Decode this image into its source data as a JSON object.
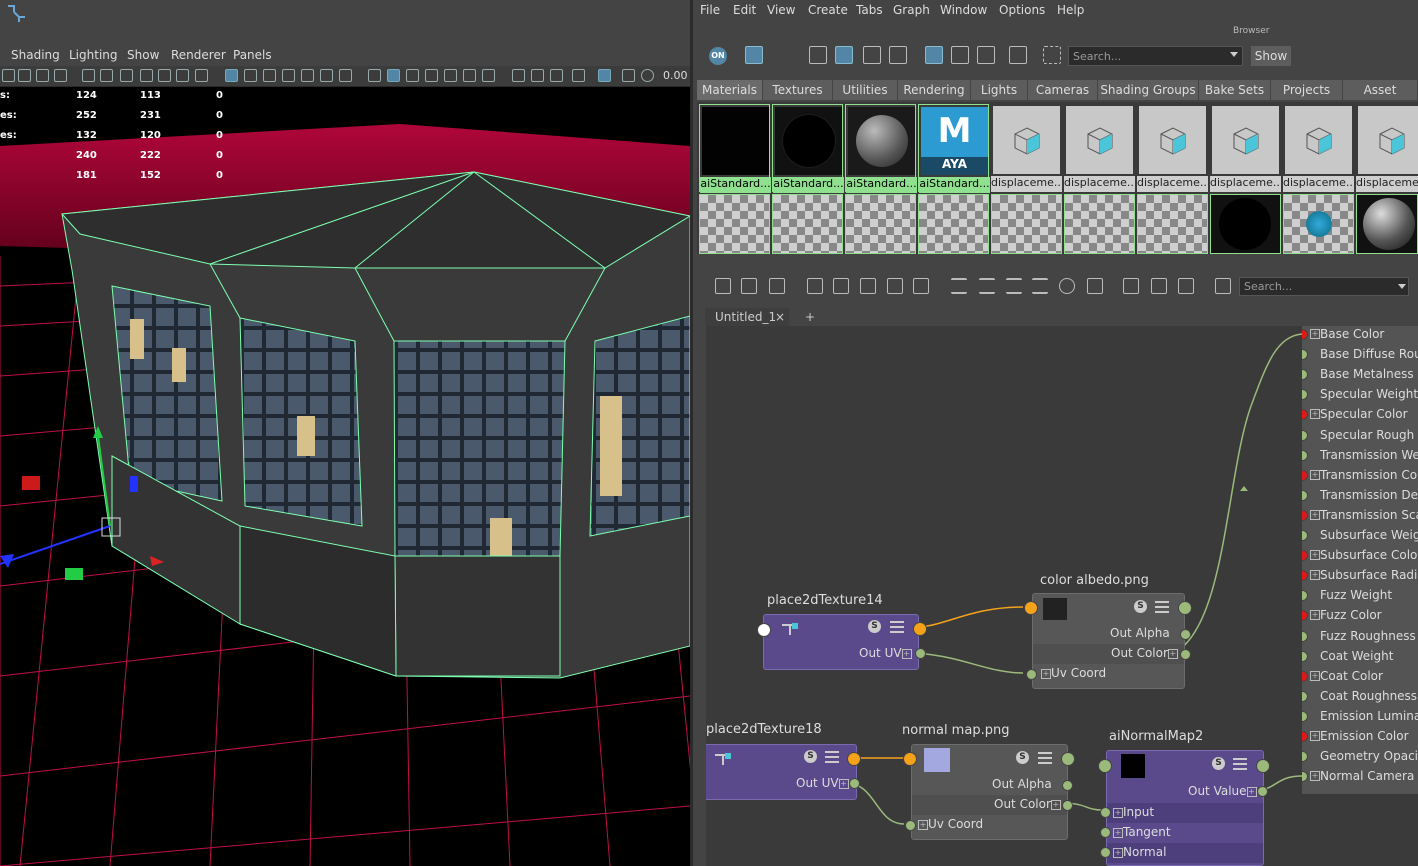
{
  "viewport": {
    "menus": [
      "Shading",
      "Lighting",
      "Show",
      "Renderer",
      "Panels"
    ],
    "zoom_value": "0.00",
    "stats": [
      {
        "label": "s:",
        "a": "124",
        "b": "113",
        "c": "0"
      },
      {
        "label": "es:",
        "a": "252",
        "b": "231",
        "c": "0"
      },
      {
        "label": "es:",
        "a": "132",
        "b": "120",
        "c": "0"
      },
      {
        "label": "",
        "a": "240",
        "b": "222",
        "c": "0"
      },
      {
        "label": "",
        "a": "181",
        "b": "152",
        "c": "0"
      }
    ]
  },
  "hypershade": {
    "menus": [
      "File",
      "Edit",
      "View",
      "Create",
      "Tabs",
      "Graph",
      "Window",
      "Options",
      "Help"
    ],
    "browser_label": "Browser",
    "on_label": "ON",
    "search_placeholder": "Search...",
    "show_label": "Show",
    "browser_tabs": [
      "Materials",
      "Textures",
      "Utilities",
      "Rendering",
      "Lights",
      "Cameras",
      "Shading Groups",
      "Bake Sets",
      "Projects",
      "Asset Nodes"
    ],
    "swatches_row1": [
      "aiStandard...",
      "aiStandard...",
      "aiStandard...",
      "aiStandard...",
      "displaceme...",
      "displaceme...",
      "displaceme...",
      "displaceme...",
      "displaceme...",
      "displaceme..."
    ],
    "maya_logo_text": "AYA",
    "maya_logo_letter": "M",
    "graph_search_placeholder": "Search...",
    "graph_tab": "Untitled_1",
    "graph_tab_close": "×",
    "graph_tab_add": "+"
  },
  "nodes": {
    "place1": {
      "title": "place2dTexture14",
      "out": "Out UV"
    },
    "place2": {
      "title": "place2dTexture18",
      "out": "Out UV"
    },
    "color": {
      "title": "color albedo.png",
      "out_alpha": "Out Alpha",
      "out_color": "Out Color",
      "uv": "Uv Coord"
    },
    "normal": {
      "title": "normal map.png",
      "out_alpha": "Out Alpha",
      "out_color": "Out Color",
      "uv": "Uv Coord"
    },
    "ainormal": {
      "title": "aiNormalMap2",
      "out_value": "Out Value",
      "input": "Input",
      "tangent": "Tangent",
      "normal": "Normal"
    },
    "s_label": "S"
  },
  "shader_attrs": [
    {
      "name": "Base Color",
      "port": "red"
    },
    {
      "name": "Base Diffuse Rou",
      "port": "green"
    },
    {
      "name": "Base Metalness",
      "port": "green"
    },
    {
      "name": "Specular Weight",
      "port": "green"
    },
    {
      "name": "Specular Color",
      "port": "red"
    },
    {
      "name": "Specular Rough",
      "port": "green"
    },
    {
      "name": "Transmission We",
      "port": "green"
    },
    {
      "name": "Transmission Co",
      "port": "red"
    },
    {
      "name": "Transmission De",
      "port": "green"
    },
    {
      "name": "Transmission Sca",
      "port": "red"
    },
    {
      "name": "Subsurface Weig",
      "port": "green"
    },
    {
      "name": "Subsurface Colo",
      "port": "red"
    },
    {
      "name": "Subsurface Radi",
      "port": "red"
    },
    {
      "name": "Fuzz Weight",
      "port": "green"
    },
    {
      "name": "Fuzz Color",
      "port": "red"
    },
    {
      "name": "Fuzz Roughness",
      "port": "green"
    },
    {
      "name": "Coat Weight",
      "port": "green"
    },
    {
      "name": "Coat Color",
      "port": "red"
    },
    {
      "name": "Coat Roughness",
      "port": "green"
    },
    {
      "name": "Emission Lumina",
      "port": "green"
    },
    {
      "name": "Emission Color",
      "port": "red"
    },
    {
      "name": "Geometry Opaci",
      "port": "green"
    },
    {
      "name": "Normal Camera",
      "port": "green"
    }
  ],
  "colors": {
    "accent": "#5285a6",
    "node_purple": "#5a4a8c",
    "connection_orange": "#f5a21b",
    "connection_green": "#9ab97a",
    "wireframe": "#7dffb0",
    "grid": "#c0104a"
  }
}
